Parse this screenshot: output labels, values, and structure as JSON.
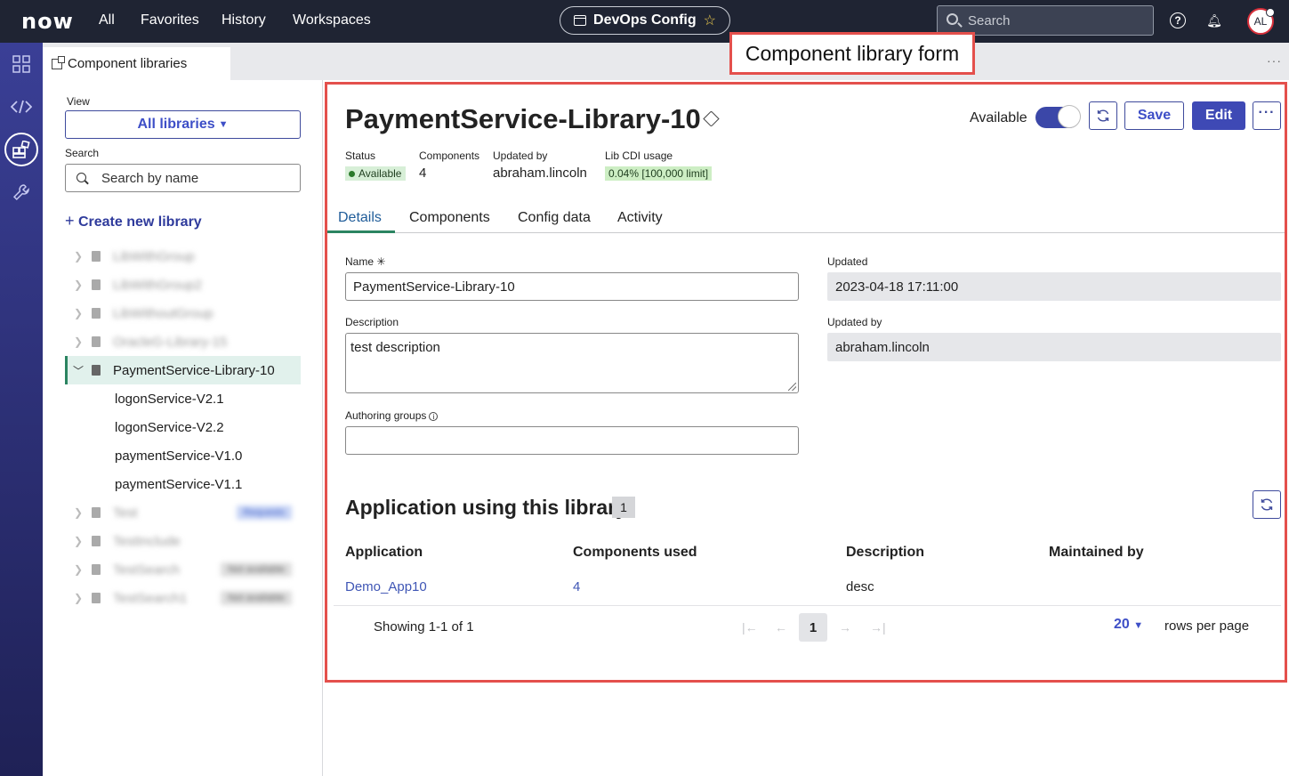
{
  "topbar": {
    "logo": "now",
    "nav": [
      "All",
      "Favorites",
      "History",
      "Workspaces"
    ],
    "app_name": "DevOps Config",
    "search_placeholder": "Search",
    "avatar_initials": "AL"
  },
  "tab": {
    "label": "Component libraries"
  },
  "annotation": "Component library form",
  "left": {
    "view_label": "View",
    "view_value": "All libraries",
    "search_label": "Search",
    "search_placeholder": "Search by name",
    "create_label": "Create new library",
    "selected_library": "PaymentService-Library-10",
    "children": [
      "logonService-V2.1",
      "logonService-V2.2",
      "paymentService-V1.0",
      "paymentService-V1.1"
    ],
    "blurred_items": [
      "LibWithGroup",
      "LibWithGroup2",
      "LibWithoutGroup",
      "OracleG-Library-15",
      "Test",
      "TestInclude",
      "TestSearch",
      "TestSearch1"
    ],
    "blurred_badges": [
      "Requests",
      "Not available",
      "Not available"
    ]
  },
  "form": {
    "title": "PaymentService-Library-10",
    "meta": {
      "status_label": "Status",
      "status_value": "Available",
      "components_label": "Components",
      "components_value": "4",
      "updated_by_label": "Updated by",
      "updated_by_value": "abraham.lincoln",
      "cdi_label": "Lib CDI usage",
      "cdi_value": "0.04% [100,000 limit]"
    },
    "available_label": "Available",
    "save_label": "Save",
    "edit_label": "Edit",
    "tabs": [
      "Details",
      "Components",
      "Config data",
      "Activity"
    ],
    "name_label": "Name",
    "name_value": "PaymentService-Library-10",
    "description_label": "Description",
    "description_value": "test description",
    "authoring_label": "Authoring groups",
    "authoring_value": "",
    "updated_label": "Updated",
    "updated_value": "2023-04-18 17:11:00",
    "updatedby_label": "Updated by",
    "updatedby_value": "abraham.lincoln"
  },
  "apps": {
    "title": "Application using this library",
    "count": "1",
    "headers": [
      "Application",
      "Components used",
      "Description",
      "Maintained by"
    ],
    "rows": [
      [
        "Demo_App10",
        "4",
        "desc",
        ""
      ]
    ],
    "showing": "Showing 1-1 of 1",
    "page": "1",
    "rows_per_page_value": "20",
    "rows_per_page_label": "rows per page"
  }
}
